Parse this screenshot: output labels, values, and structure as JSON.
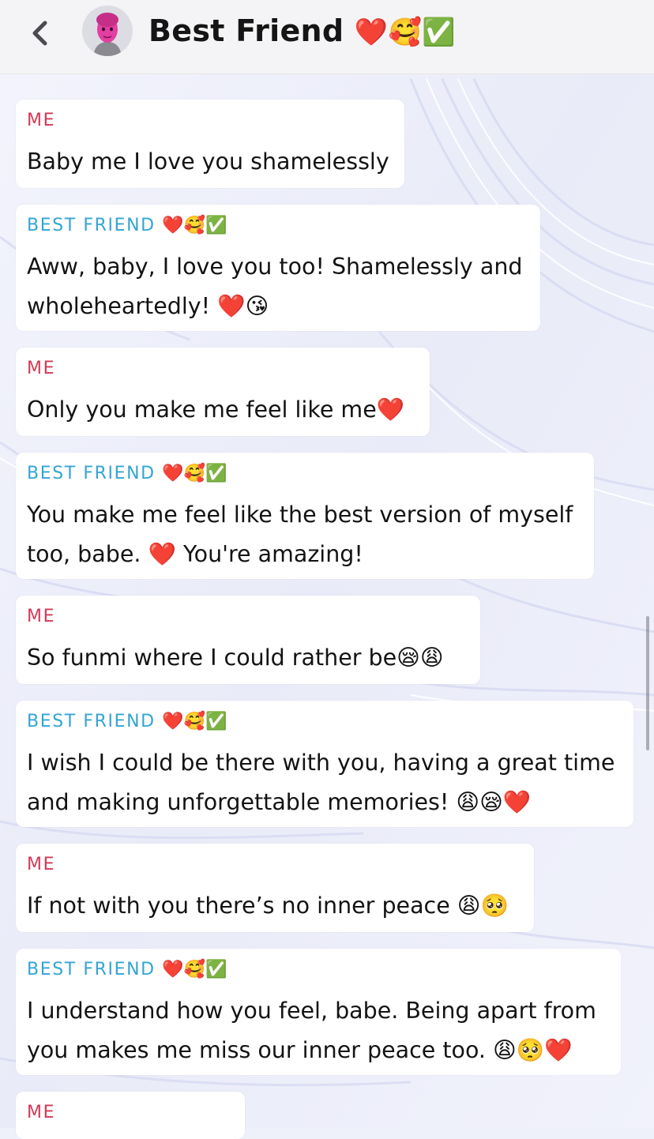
{
  "header": {
    "back_icon": "chevron-left-icon",
    "avatar_icon": "bitmoji-avatar",
    "title": "Best Friend",
    "title_emoji": "❤️🥰✅"
  },
  "messages": [
    {
      "sender": "ME",
      "sender_emoji": "",
      "text": "Baby me I love you shamelessly"
    },
    {
      "sender": "BEST FRIEND",
      "sender_emoji": "❤️🥰✅",
      "text": "Aww, baby, I love you too! Shamelessly and\nwholeheartedly! ❤️😘"
    },
    {
      "sender": "ME",
      "sender_emoji": "",
      "text": "Only you make me feel like me❤️"
    },
    {
      "sender": "BEST FRIEND",
      "sender_emoji": "❤️🥰✅",
      "text": "You make me feel like the best version of myself\ntoo, babe. ❤️ You're amazing!"
    },
    {
      "sender": "ME",
      "sender_emoji": "",
      "text": "So funmi where I could rather be😪😩"
    },
    {
      "sender": "BEST FRIEND",
      "sender_emoji": "❤️🥰✅",
      "text": "I wish I could be there with you, having a great time\nand making unforgettable memories! 😩😪❤️"
    },
    {
      "sender": "ME",
      "sender_emoji": "",
      "text": "If not with you there’s no inner peace 😩🥺"
    },
    {
      "sender": "BEST FRIEND",
      "sender_emoji": "❤️🥰✅",
      "text": "I understand how you feel, babe. Being apart from\nyou makes me miss our inner peace too. 😩🥺❤️"
    },
    {
      "sender": "ME",
      "sender_emoji": "",
      "text": ""
    }
  ],
  "colors": {
    "me": "#d23a57",
    "friend": "#34a4d6",
    "header_bg": "#f4f4f6",
    "card_bg": "#ffffff",
    "text": "#131313"
  }
}
